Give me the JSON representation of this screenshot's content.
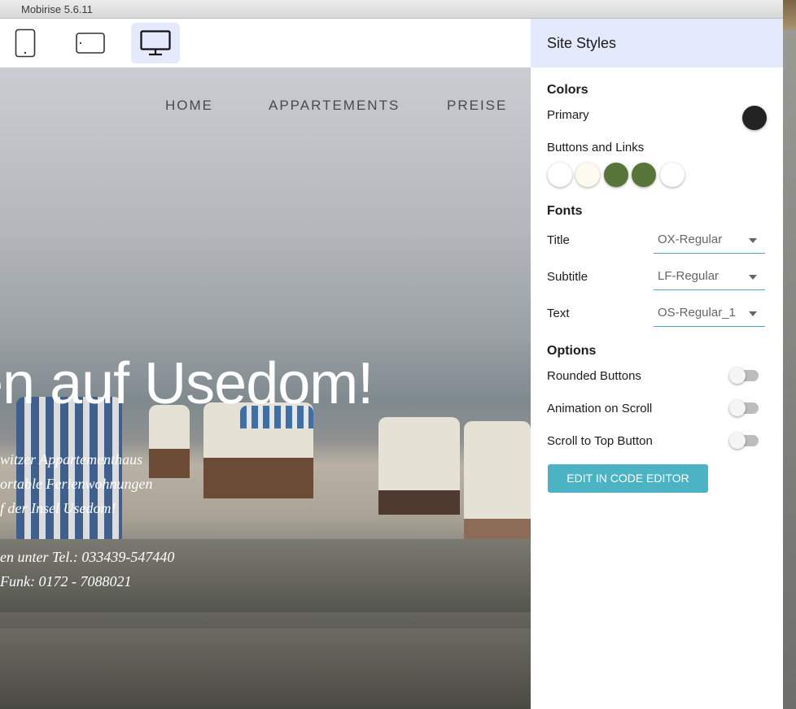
{
  "window": {
    "title": "Mobirise 5.6.11"
  },
  "toolbar": {
    "devices": [
      {
        "name": "phone",
        "icon": "phone-icon",
        "active": false
      },
      {
        "name": "tablet",
        "icon": "tablet-icon",
        "active": false
      },
      {
        "name": "desktop",
        "icon": "desktop-icon",
        "active": true
      }
    ]
  },
  "preview": {
    "nav": [
      "HOME",
      "APPARTEMENTS",
      "PREISE"
    ],
    "hero_title": "en auf Usedom!",
    "hero_lines": [
      "witzer Appartementhaus",
      "ortable Ferienwohnungen",
      "f der Insel Usedom!",
      "",
      "en unter Tel.: 033439-547440",
      "Funk: 0172 - 7088021"
    ]
  },
  "panel": {
    "title": "Site Styles",
    "colors": {
      "heading": "Colors",
      "primary_label": "Primary",
      "primary_color": "#232323",
      "buttons_label": "Buttons and Links",
      "button_colors": [
        "#ffffff",
        "#fffaf0",
        "#577538",
        "#577538",
        "#ffffff"
      ]
    },
    "fonts": {
      "heading": "Fonts",
      "title_label": "Title",
      "title_value": "OX-Regular",
      "subtitle_label": "Subtitle",
      "subtitle_value": "LF-Regular",
      "text_label": "Text",
      "text_value": "OS-Regular_1"
    },
    "options": {
      "heading": "Options",
      "rounded_label": "Rounded Buttons",
      "rounded_on": false,
      "animation_label": "Animation on Scroll",
      "animation_on": false,
      "scroll_top_label": "Scroll to Top Button",
      "scroll_top_on": false
    },
    "edit_code_label": "EDIT IN CODE EDITOR"
  },
  "accent": "#4cb3c4"
}
